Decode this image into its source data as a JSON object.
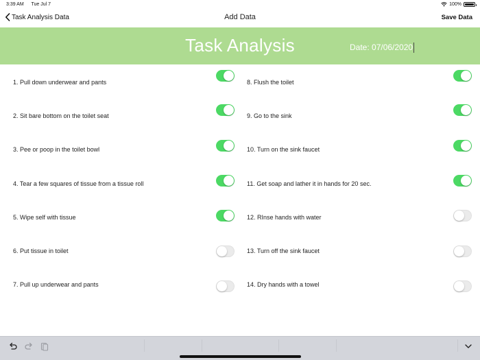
{
  "status": {
    "time": "3:39 AM",
    "date": "Tue Jul 7",
    "battery": "100%"
  },
  "nav": {
    "back_label": "Task Analysis Data",
    "title": "Add Data",
    "save_label": "Save Data"
  },
  "banner": {
    "title": "Task Analysis",
    "date_text": "Date: 07/06/2020",
    "color": "#aedb91"
  },
  "tasks": [
    {
      "label": "1. Pull down underwear and pants",
      "checked": true
    },
    {
      "label": "2. Sit bare bottom on the toilet seat",
      "checked": true
    },
    {
      "label": "3. Pee or poop in the toilet bowl",
      "checked": true
    },
    {
      "label": "4. Tear a few squares of tissue from a tissue roll",
      "checked": true
    },
    {
      "label": "5. Wipe self with tissue",
      "checked": true
    },
    {
      "label": "6. Put tissue in toilet",
      "checked": false
    },
    {
      "label": "7. Pull up underwear and pants",
      "checked": false
    },
    {
      "label": "8. Flush the toilet",
      "checked": true
    },
    {
      "label": "9. Go to the sink",
      "checked": true
    },
    {
      "label": "10. Turn on the sink faucet",
      "checked": true
    },
    {
      "label": "11. Get soap and lather it in hands for 20 sec.",
      "checked": true
    },
    {
      "label": "12. RInse hands with water",
      "checked": false
    },
    {
      "label": "13. Turn off the sink faucet",
      "checked": false
    },
    {
      "label": "14. Dry hands with a towel",
      "checked": false
    }
  ],
  "colors": {
    "toggle_on": "#4cd964",
    "toggle_off": "#ebebeb"
  },
  "keyboard_toolbar": {
    "icons": [
      "undo-icon",
      "redo-icon",
      "paste-icon",
      "chevron-down-icon"
    ]
  }
}
